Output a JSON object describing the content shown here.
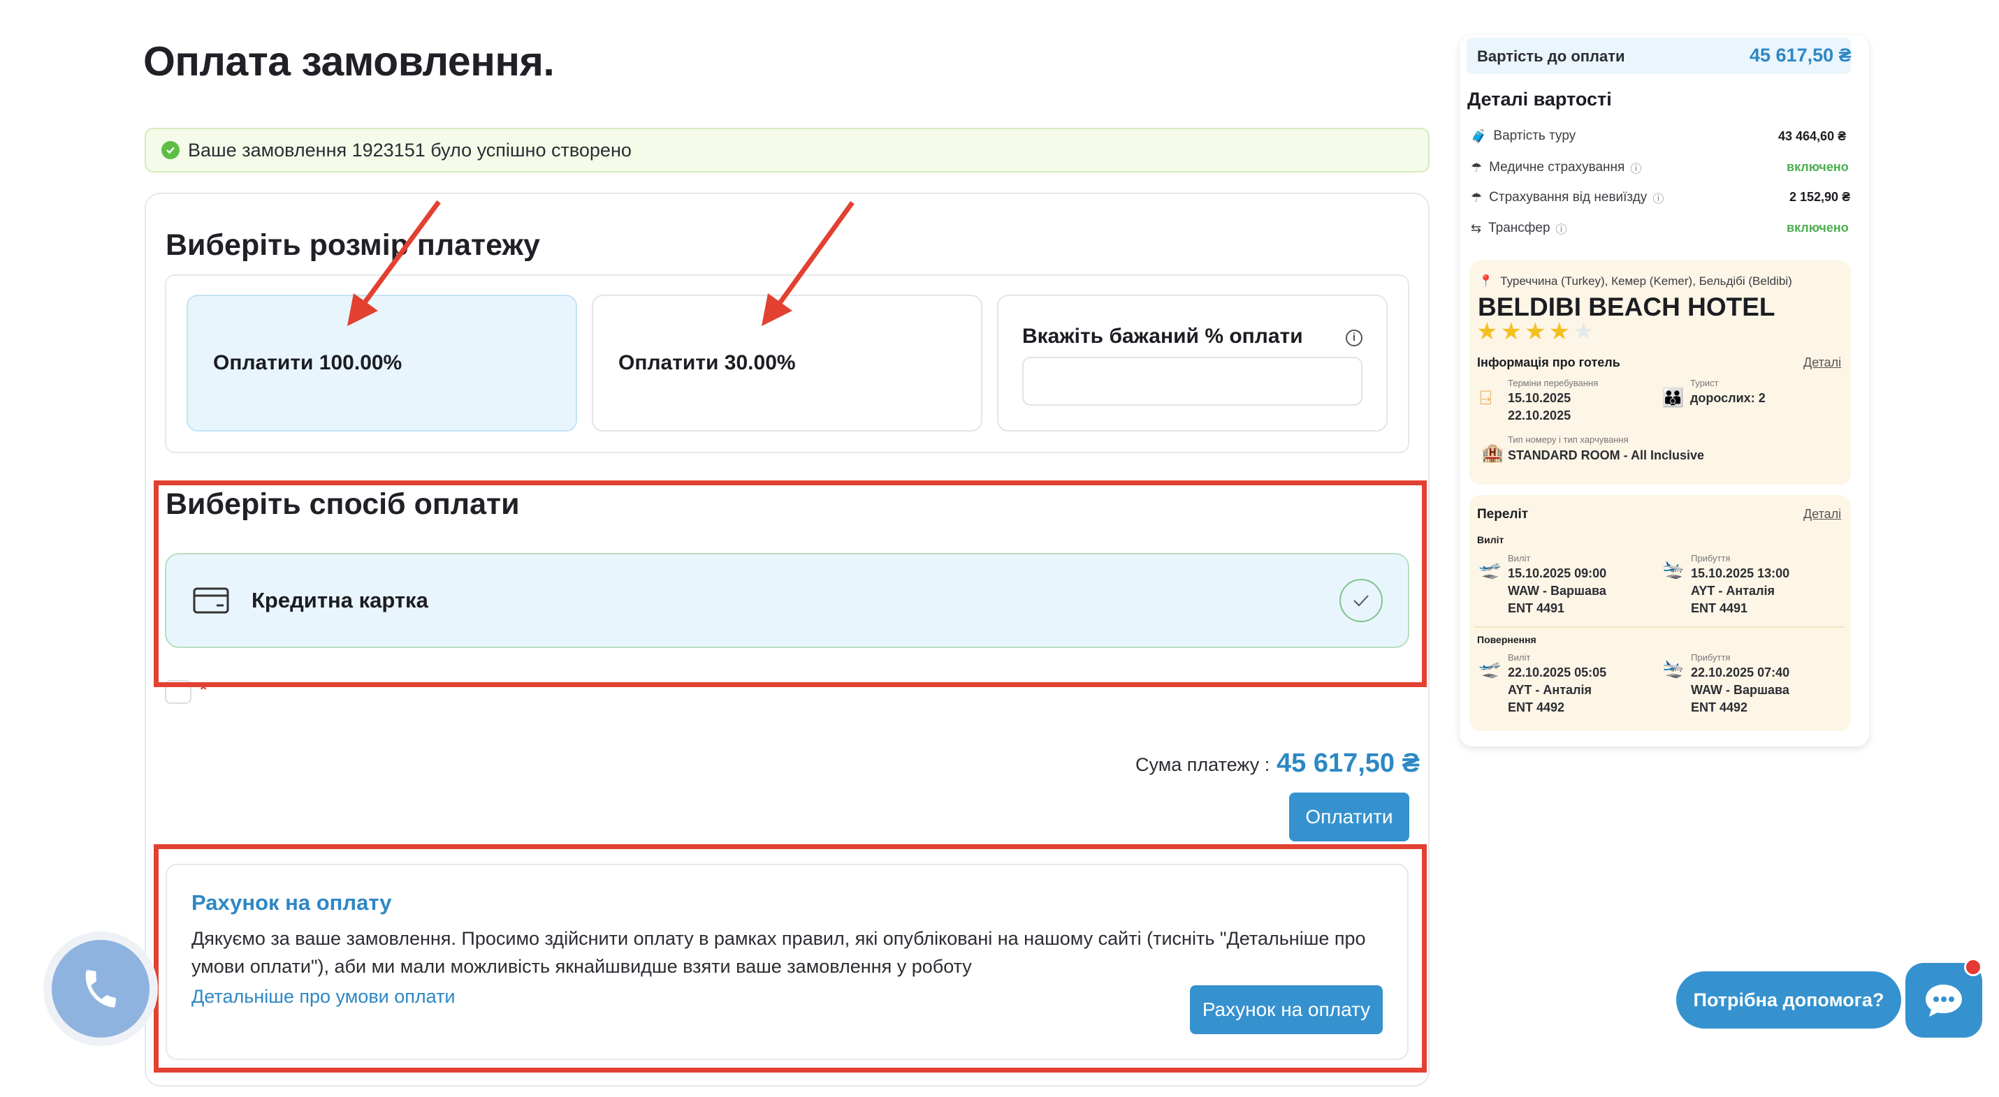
{
  "page": {
    "title": "Оплата замовлення."
  },
  "alert": {
    "message": "Ваше замовлення 1923151 було успішно створено"
  },
  "payment_size": {
    "heading": "Виберіть розмір платежу",
    "option_full": "Оплатити 100.00%",
    "option_partial": "Оплатити 30.00%",
    "custom_label": "Вкажіть бажаний % оплати",
    "custom_value": ""
  },
  "payment_method": {
    "heading": "Виберіть спосіб оплати",
    "card_label": "Кредитна картка"
  },
  "terms": {
    "required_mark": "*"
  },
  "total": {
    "label": "Сума платежу :",
    "value": "45 617,50 ₴",
    "pay_button": "Оплатити"
  },
  "invoice": {
    "title": "Рахунок на оплату",
    "text": "Дякуємо за ваше замовлення. Просимо здійснити оплату в рамках правил, які опубліковані на нашому сайті (тисніть \"Детальніше про умови оплати\"), аби ми мали можливість якнайшвидше взяти ваше замовлення у роботу",
    "link": "Детальніше про умови оплати",
    "button": "Рахунок на оплату"
  },
  "summary": {
    "due_label": "Вартість до оплати",
    "due_value": "45 617,50 ₴",
    "details_heading": "Деталі вартості",
    "rows": [
      {
        "icon": "tour-icon",
        "label": "Вартість туру",
        "value": "43 464,60 ₴"
      },
      {
        "icon": "umbrella-icon",
        "label": "Медичне страхування",
        "value": "включено"
      },
      {
        "icon": "umbrella-icon",
        "label": "Страхування від невиїзду",
        "value": "2 152,90 ₴"
      },
      {
        "icon": "transfer-icon",
        "label": "Трансфер",
        "value": "включено"
      }
    ]
  },
  "hotel": {
    "location": "Туреччина (Turkey), Кемер (Kemer), Бельдібі (Beldibi)",
    "name": "BELDIBI BEACH HOTEL",
    "stars": 4,
    "stars_max": 5,
    "info_label": "Інформація про готель",
    "details_link": "Деталі",
    "dates_label": "Терміни перебування",
    "date_from": "15.10.2025",
    "date_to": "22.10.2025",
    "tourist_label": "Турист",
    "tourist_value": "дорослих: 2",
    "room_label": "Тип номеру і тип харчування",
    "room_value": "STANDARD ROOM - All Inclusive"
  },
  "flights": {
    "title": "Переліт",
    "details_link": "Деталі",
    "outbound_label": "Виліт",
    "return_label": "Повернення",
    "depart_label": "Виліт",
    "arrive_label": "Прибуття",
    "outbound": {
      "depart": {
        "time": "15.10.2025 09:00",
        "place": "WAW - Варшава",
        "flight": "ENT 4491"
      },
      "arrive": {
        "time": "15.10.2025 13:00",
        "place": "AYT - Анталія",
        "flight": "ENT 4491"
      }
    },
    "return": {
      "depart": {
        "time": "22.10.2025 05:05",
        "place": "AYT - Анталія",
        "flight": "ENT 4492"
      },
      "arrive": {
        "time": "22.10.2025 07:40",
        "place": "WAW - Варшава",
        "flight": "ENT 4492"
      }
    }
  },
  "support": {
    "help_label": "Потрібна допомога?"
  },
  "colors": {
    "accent": "#3592cf",
    "annotation": "#e24131",
    "success": "#5fbd45"
  }
}
